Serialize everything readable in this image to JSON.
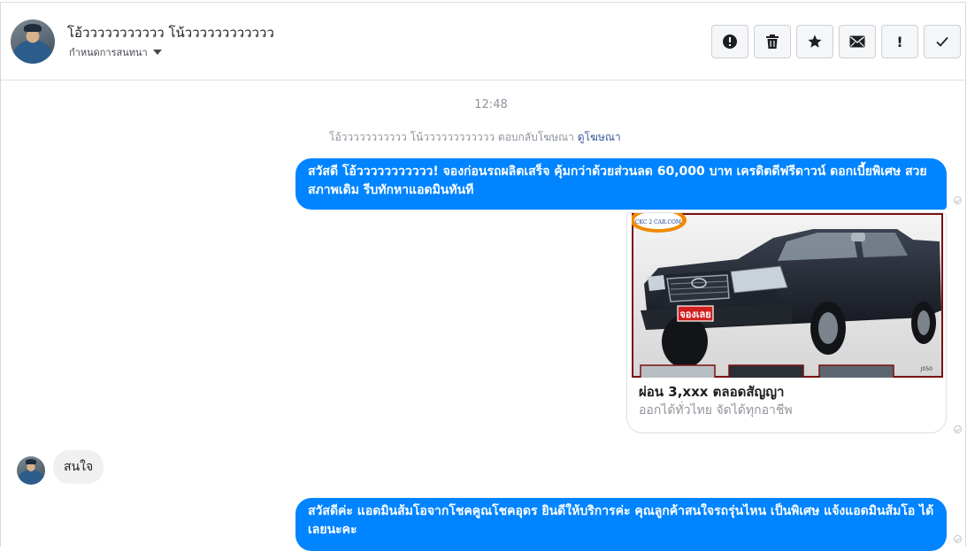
{
  "header": {
    "name": "โอ้ววววววววววว โน้วววววววววววว",
    "assign_label": "กำหนดการสนทนา",
    "actions": [
      {
        "name": "spam-button",
        "icon": "alert-circle-icon"
      },
      {
        "name": "delete-button",
        "icon": "trash-icon"
      },
      {
        "name": "star-button",
        "icon": "star-icon"
      },
      {
        "name": "mark-unread-button",
        "icon": "envelope-icon"
      },
      {
        "name": "important-button",
        "icon": "exclamation-icon",
        "label": "!"
      },
      {
        "name": "done-button",
        "icon": "check-icon"
      }
    ]
  },
  "thread": {
    "timestamp": "12:48",
    "system_line": {
      "text": "โอ้ววววววววววว โน้วววววววววววว ตอบกลับโฆษณา",
      "link": "ดูโฆษณา"
    },
    "messages": [
      {
        "direction": "outgoing",
        "text": "สวัสดี โอ้ววววววววววว! จองก่อนรถผลิตเสร็จ คุ้มกว่าด้วยส่วนลด 60,000 บาท เครดิตดีฟรีดาวน์ ดอกเบี้ยพิเศษ สวยสภาพเดิม รีบทักหาแอดมินทันที"
      },
      {
        "direction": "outgoing",
        "type": "card",
        "title": "ผ่อน 3,xxx ตลอดสัญญา",
        "subtitle": "ออกได้ทั่วไทย จัดได้ทุกอาชีพ",
        "image": {
          "logo_text": "CKC 2 CAR.COM",
          "badge_text": "จองเลย",
          "plate_text": "J050"
        }
      },
      {
        "direction": "incoming",
        "text": "สนใจ"
      },
      {
        "direction": "outgoing",
        "text": "สวัสดีค่ะ แอดมินส้มโอจากโชคคูณโชคอุดร ยินดีให้บริการค่ะ   คุณลูกค้าสนใจรถรุ่นไหน เป็นพิเศษ แจ้งแอดมินส้มโอ ได้เลยนะคะ"
      }
    ]
  },
  "colors": {
    "outgoing_bubble": "#0084ff",
    "incoming_bubble": "#f1f0f0",
    "link": "#385898"
  }
}
